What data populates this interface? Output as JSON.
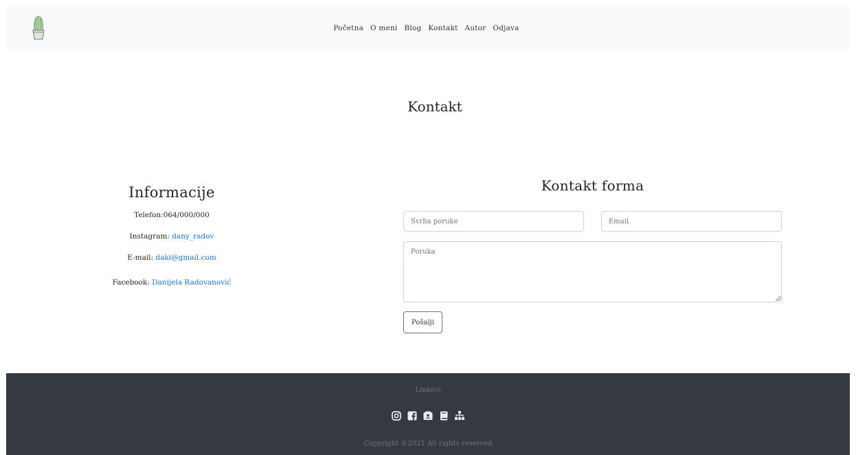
{
  "nav": {
    "logo_icon": "cactus-icon",
    "links": [
      "Početna",
      "O meni",
      "Blog",
      "Kontakt",
      "Autor",
      "Odjava"
    ]
  },
  "page_title": "Kontakt",
  "info": {
    "heading": "Informacije",
    "phone": "Telefon:064/000/000",
    "instagram_label": "Instagram: ",
    "instagram_value": "dany_radov",
    "email_label": "E-mail: ",
    "email_value": "daki@gmail.com",
    "facebook_label": "Facebook: ",
    "facebook_value": "Danijela Radovanović"
  },
  "form": {
    "title": "Kontakt forma",
    "subject_placeholder": "Svrha poruke",
    "email_placeholder": "Email",
    "message_placeholder": "Poruka",
    "submit_label": "Pošalji"
  },
  "footer": {
    "title": "Linkovi",
    "icons": [
      "instagram-icon",
      "facebook-icon",
      "contact-icon",
      "book-icon",
      "sitemap-icon"
    ],
    "copyright": "Copyright ©2021 All rights reserved"
  },
  "colors": {
    "nav_bg": "#f8f9fa",
    "link": "#1a73e8",
    "footer_bg": "#343a40",
    "footer_text": "#6c757d",
    "footer_icon": "#e9ecef"
  }
}
